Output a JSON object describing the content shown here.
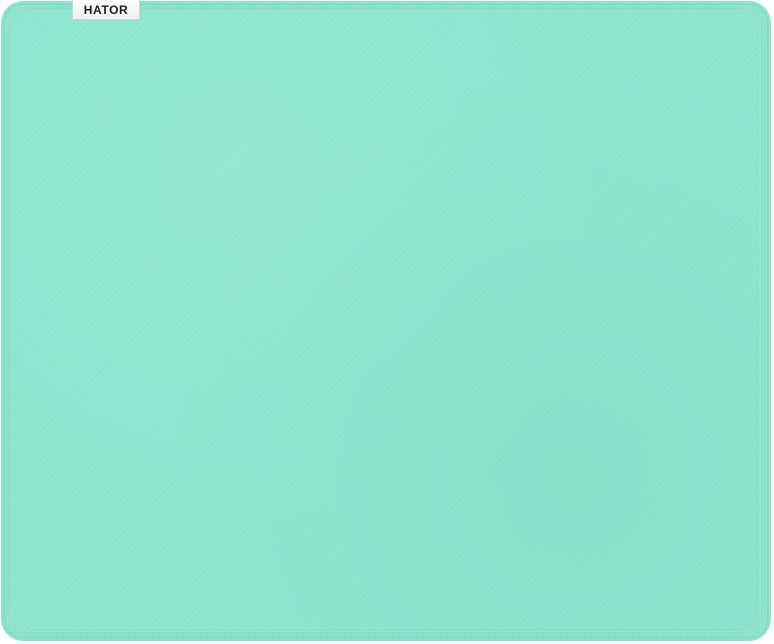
{
  "product": {
    "brand_tag": "HATOR"
  },
  "colors": {
    "mousepad_edge": "#80e1c7",
    "mousepad_surface": "#8ce7cf",
    "tag_background": "#ffffff",
    "tag_text": "#1d1d1d"
  }
}
